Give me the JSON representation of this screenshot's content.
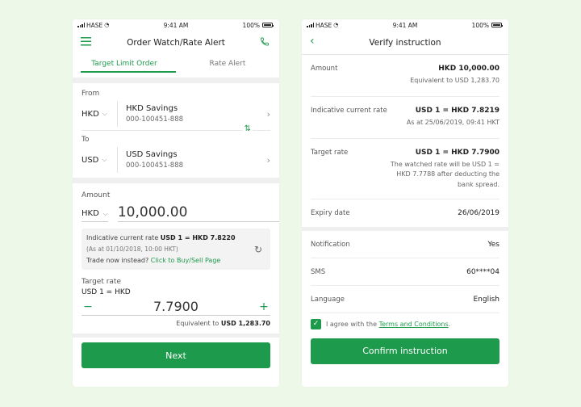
{
  "theme": {
    "accent": "#1e9a4c",
    "background": "#eef8e8"
  },
  "status_bar": {
    "carrier": "HASE",
    "time": "9:41 AM",
    "battery": "100%"
  },
  "left": {
    "nav": {
      "title": "Order Watch/Rate Alert",
      "menu_icon": "hamburger-icon",
      "call_icon": "phone-icon"
    },
    "tabs": [
      {
        "label": "Target Limit Order",
        "active": true
      },
      {
        "label": "Rate Alert",
        "active": false
      }
    ],
    "from": {
      "label": "From",
      "currency": "HKD",
      "account_name": "HKD Savings",
      "account_number": "000-100451-888"
    },
    "to": {
      "label": "To",
      "currency": "USD",
      "account_name": "USD Savings",
      "account_number": "000-100451-888"
    },
    "amount": {
      "label": "Amount",
      "currency": "HKD",
      "value": "10,000.00",
      "rate_prefix": "Indicative current rate",
      "rate_value": "USD 1 = HKD 7.8220",
      "as_at": "(As at 01/10/2018, 10:00 HKT)",
      "trade_prefix": "Trade now instead?",
      "trade_link": "Click to Buy/Sell Page"
    },
    "target": {
      "label": "Target rate",
      "pair": "USD 1 = HKD",
      "value": "7.7900",
      "minus": "−",
      "plus": "+",
      "equiv_prefix": "Equivalent to",
      "equiv_value": "USD 1,283.70"
    },
    "next_button": "Next"
  },
  "right": {
    "nav": {
      "title": "Verify instruction",
      "back_icon": "chevron-left-icon"
    },
    "rows": {
      "amount": {
        "label": "Amount",
        "value": "HKD 10,000.00",
        "sub": "Equivalent to USD 1,283.70"
      },
      "current_rate": {
        "label": "Indicative current rate",
        "value": "USD 1 = HKD 7.8219",
        "sub": "As at 25/06/2019, 09:41 HKT"
      },
      "target_rate": {
        "label": "Target rate",
        "value": "USD 1 = HKD 7.7900",
        "sub": "The watched rate will be USD 1 = HKD 7.7788 after deducting the bank spread."
      },
      "expiry": {
        "label": "Expiry date",
        "value": "26/06/2019"
      },
      "notification": {
        "label": "Notification",
        "value": "Yes"
      },
      "sms": {
        "label": "SMS",
        "value": "60****04"
      },
      "language": {
        "label": "Language",
        "value": "English"
      }
    },
    "agree": {
      "prefix": "I agree with the",
      "link": "Terms and Conditions",
      "suffix": ".",
      "checked": true
    },
    "confirm_button": "Confirm instruction"
  }
}
